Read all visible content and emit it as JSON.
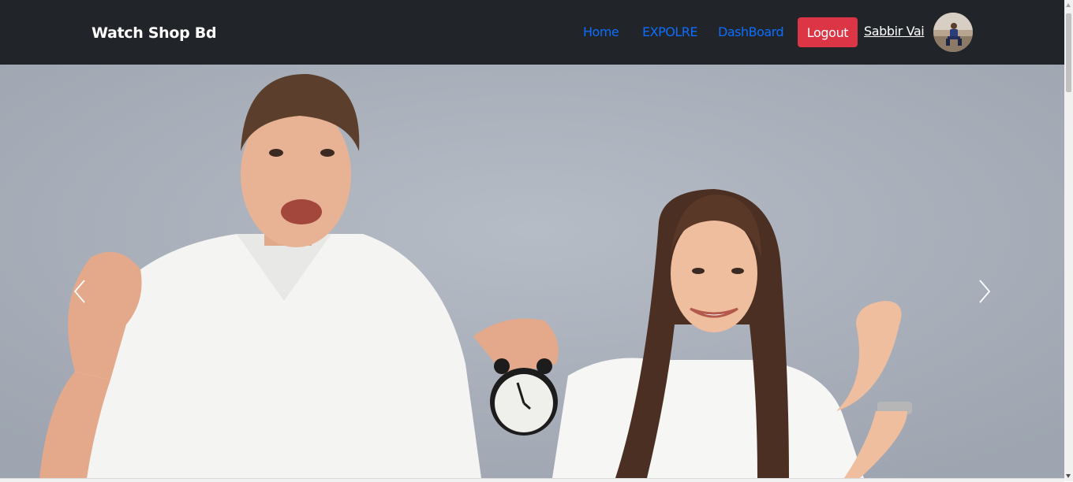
{
  "navbar": {
    "brand": "Watch Shop Bd",
    "links": [
      {
        "label": "Home"
      },
      {
        "label": "EXPOLRE"
      },
      {
        "label": "DashBoard"
      }
    ],
    "logout_label": "Logout",
    "user_name": "Sabbir Vai"
  },
  "carousel": {
    "prev_icon": "chevron-left-icon",
    "next_icon": "chevron-right-icon"
  },
  "colors": {
    "navbar_bg": "#212529",
    "link": "#0d6efd",
    "logout_bg": "#dc3545",
    "hero_bg": "#a9afb9"
  }
}
